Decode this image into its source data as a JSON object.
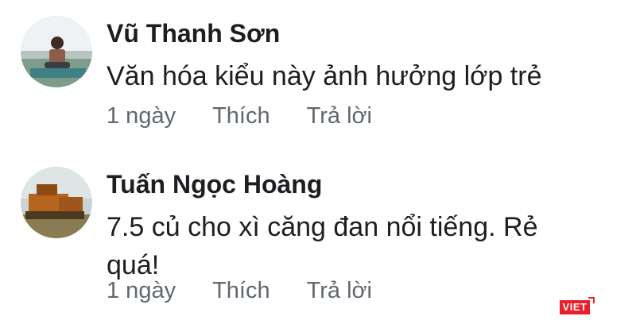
{
  "comments": [
    {
      "author": "Vũ Thanh Sơn",
      "text": "Văn hóa kiểu này ảnh hưởng lớp trẻ",
      "time": "1 ngày",
      "like_label": "Thích",
      "reply_label": "Trả lời"
    },
    {
      "author": "Tuấn Ngọc Hoàng",
      "text": "7.5 củ cho xì căng đan nổi tiếng. Rẻ quá!",
      "time": "1 ngày",
      "like_label": "Thích",
      "reply_label": "Trả lời"
    }
  ],
  "watermark": {
    "text": "VIET",
    "color": "#e8202a"
  },
  "colors": {
    "text": "#1c1e21",
    "meta": "#606770"
  }
}
